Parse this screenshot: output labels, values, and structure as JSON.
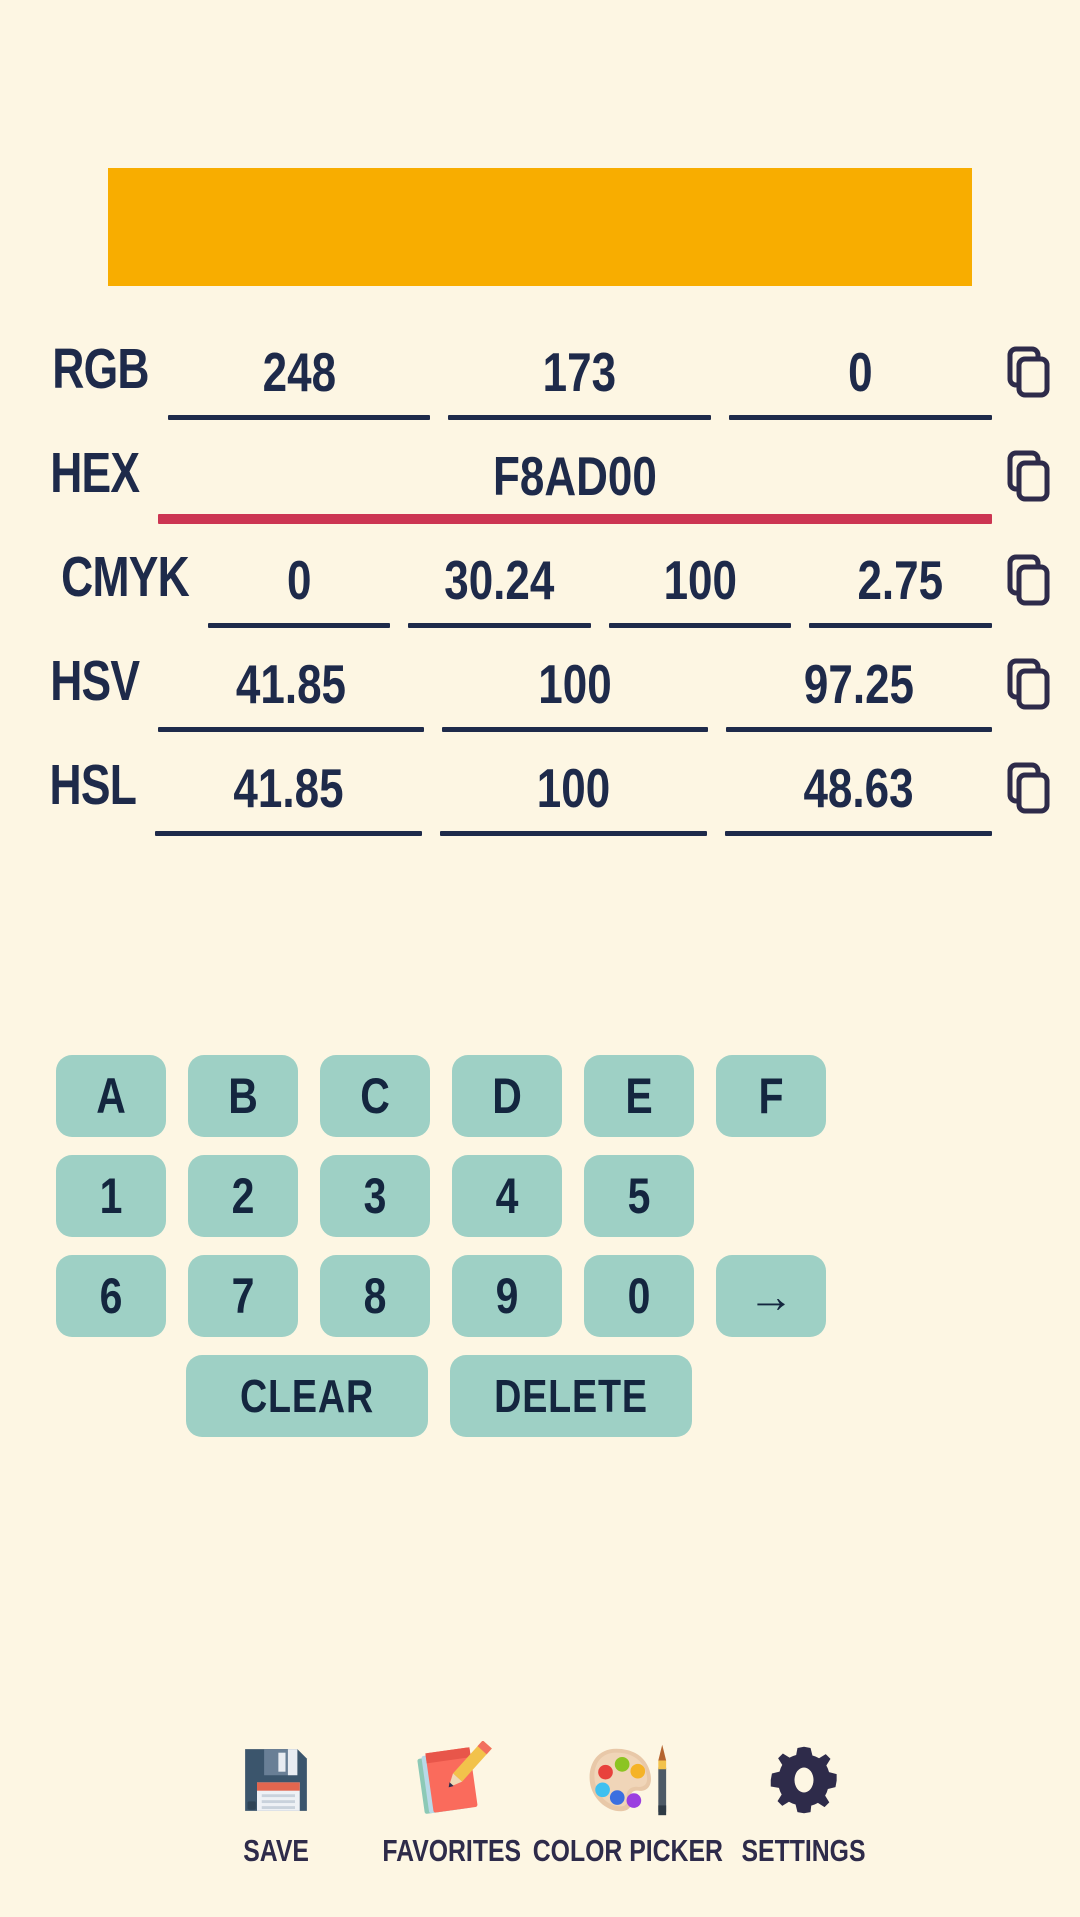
{
  "swatch": {
    "color": "#F8AD00",
    "name": "color-preview-swatch"
  },
  "theme": {
    "background": "#FDF6E3",
    "text": "#1E2A4A",
    "key_bg": "#9ED0C5",
    "active_underline": "#CC3552",
    "underline": "#1E2A4A"
  },
  "rows": [
    {
      "label": "RGB",
      "fields": [
        "248",
        "173",
        "0"
      ],
      "active": -1,
      "copy_label": "copy"
    },
    {
      "label": "HEX",
      "fields": [
        "F8AD00"
      ],
      "active": 0,
      "copy_label": "copy"
    },
    {
      "label": "CMYK",
      "fields": [
        "0",
        "30.24",
        "100",
        "2.75"
      ],
      "active": -1,
      "copy_label": "copy"
    },
    {
      "label": "HSV",
      "fields": [
        "41.85",
        "100",
        "97.25"
      ],
      "active": -1,
      "copy_label": "copy"
    },
    {
      "label": "HSL",
      "fields": [
        "41.85",
        "100",
        "48.63"
      ],
      "active": -1,
      "copy_label": "copy"
    }
  ],
  "keypad": {
    "row1": [
      "A",
      "B",
      "C",
      "D",
      "E",
      "F"
    ],
    "row2": [
      "1",
      "2",
      "3",
      "4",
      "5"
    ],
    "row3": [
      "6",
      "7",
      "8",
      "9",
      "0"
    ],
    "enter": "→",
    "clear": "CLEAR",
    "delete": "DELETE"
  },
  "bottom_nav": [
    {
      "label": "SAVE",
      "icon": "floppy-disk-icon"
    },
    {
      "label": "FAVORITES",
      "icon": "notepad-pencil-icon"
    },
    {
      "label": "COLOR PICKER",
      "icon": "paint-palette-icon"
    },
    {
      "label": "SETTINGS",
      "icon": "gear-icon"
    }
  ]
}
